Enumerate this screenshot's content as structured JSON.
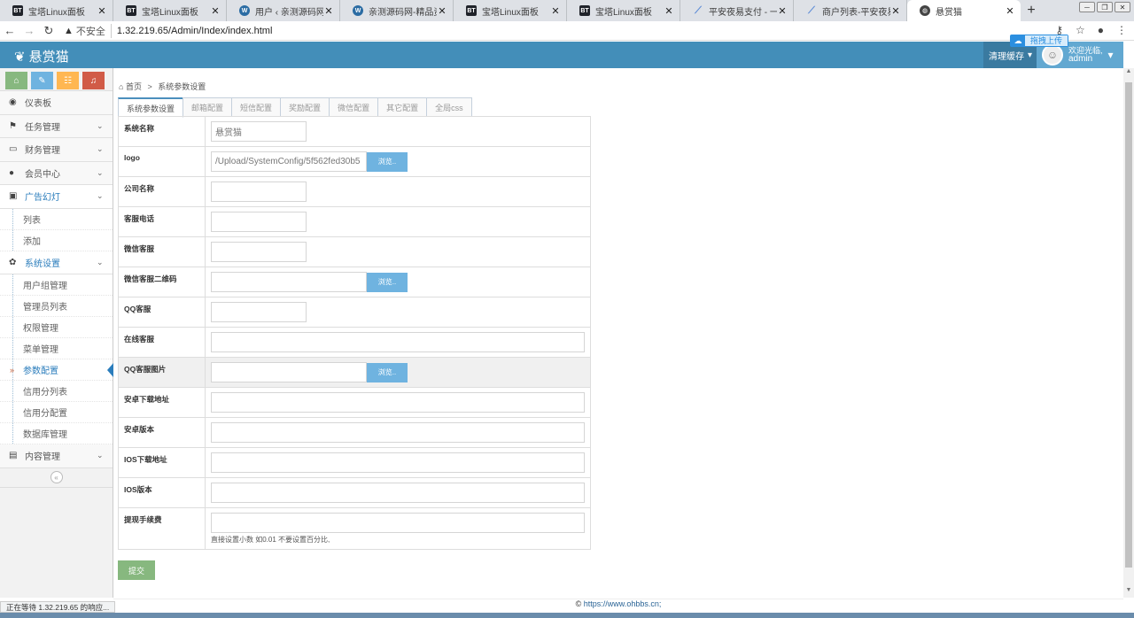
{
  "browser": {
    "tabs": [
      {
        "title": "宝塔Linux面板",
        "icon": "bt-icon",
        "badge": "BT",
        "active": false
      },
      {
        "title": "宝塔Linux面板",
        "icon": "bt-icon",
        "badge": "BT",
        "active": false
      },
      {
        "title": "用户 ‹ 亲测源码网 — W",
        "icon": "wordpress-icon",
        "badge": "W",
        "active": false
      },
      {
        "title": "亲测源码网-精品资源站",
        "icon": "wordpress-icon",
        "badge": "W",
        "active": false
      },
      {
        "title": "宝塔Linux面板",
        "icon": "bt-icon",
        "badge": "BT",
        "active": false
      },
      {
        "title": "宝塔Linux面板",
        "icon": "bt-icon",
        "badge": "BT",
        "active": false
      },
      {
        "title": "平安夜易支付 - 一站式",
        "icon": "pay-icon",
        "badge": "",
        "active": false
      },
      {
        "title": "商户列表-平安夜易支付",
        "icon": "pay-icon",
        "badge": "",
        "active": false
      },
      {
        "title": "悬赏猫",
        "icon": "globe-icon",
        "badge": "",
        "active": true
      }
    ],
    "address": {
      "security_label": "不安全",
      "url": "1.32.219.65/Admin/Index/index.html"
    },
    "status_text": "正在等待 1.32.219.65 的响应..."
  },
  "header": {
    "logo_text": "悬赏猫",
    "clear_cache_label": "清理缓存",
    "welcome_text": "欢迎光临,",
    "username": "admin",
    "upload_badge": "拖拽上传"
  },
  "sidebar": {
    "items": [
      {
        "label": "仪表板",
        "icon": "dashboard-icon",
        "glyph": "◉",
        "chevron": false,
        "open": false
      },
      {
        "label": "任务管理",
        "icon": "flag-icon",
        "glyph": "⚑",
        "chevron": true,
        "open": false
      },
      {
        "label": "财务管理",
        "icon": "inbox-icon",
        "glyph": "▭",
        "chevron": true,
        "open": false
      },
      {
        "label": "会员中心",
        "icon": "user-icon",
        "glyph": "●",
        "chevron": true,
        "open": false
      },
      {
        "label": "广告幻灯",
        "icon": "picture-icon",
        "glyph": "▣",
        "chevron": true,
        "open": true,
        "children": [
          {
            "label": "列表",
            "active": false
          },
          {
            "label": "添加",
            "active": false
          }
        ]
      },
      {
        "label": "系统设置",
        "icon": "cog-icon",
        "glyph": "✿",
        "chevron": true,
        "open": true,
        "children": [
          {
            "label": "用户组管理",
            "active": false
          },
          {
            "label": "管理员列表",
            "active": false
          },
          {
            "label": "权限管理",
            "active": false
          },
          {
            "label": "菜单管理",
            "active": false
          },
          {
            "label": "参数配置",
            "active": true
          },
          {
            "label": "信用分列表",
            "active": false
          },
          {
            "label": "信用分配置",
            "active": false
          },
          {
            "label": "数据库管理",
            "active": false
          }
        ]
      },
      {
        "label": "内容管理",
        "icon": "book-icon",
        "glyph": "▤",
        "chevron": true,
        "open": false
      }
    ]
  },
  "breadcrumb": {
    "home": "首页",
    "current": "系统参数设置"
  },
  "tabs": [
    "系统参数设置",
    "邮箱配置",
    "短信配置",
    "奖励配置",
    "微信配置",
    "其它配置",
    "全局css"
  ],
  "form": {
    "rows": [
      {
        "label": "系统名称",
        "type": "short",
        "value": "悬赏猫"
      },
      {
        "label": "logo",
        "type": "file",
        "value": "/Upload/SystemConfig/5f562fed30b5"
      },
      {
        "label": "公司名称",
        "type": "short",
        "value": ""
      },
      {
        "label": "客服电话",
        "type": "short",
        "value": ""
      },
      {
        "label": "微信客服",
        "type": "short",
        "value": ""
      },
      {
        "label": "微信客服二维码",
        "type": "file",
        "value": ""
      },
      {
        "label": "QQ客服",
        "type": "short",
        "value": ""
      },
      {
        "label": "在线客服",
        "type": "full",
        "value": ""
      },
      {
        "label": "QQ客服图片",
        "type": "file",
        "value": "",
        "highlight": true
      },
      {
        "label": "安卓下载地址",
        "type": "full",
        "value": ""
      },
      {
        "label": "安卓版本",
        "type": "full",
        "value": ""
      },
      {
        "label": "IOS下载地址",
        "type": "full",
        "value": ""
      },
      {
        "label": "IOS版本",
        "type": "full",
        "value": ""
      },
      {
        "label": "提现手续费",
        "type": "full",
        "value": "",
        "hint": "直接设置小数 如0.01 不要设置百分比,"
      }
    ],
    "browse_label": "浏览..",
    "submit_label": "提交"
  },
  "footer": {
    "copyright": "©",
    "link": "https://www.ohbbs.cn;"
  }
}
